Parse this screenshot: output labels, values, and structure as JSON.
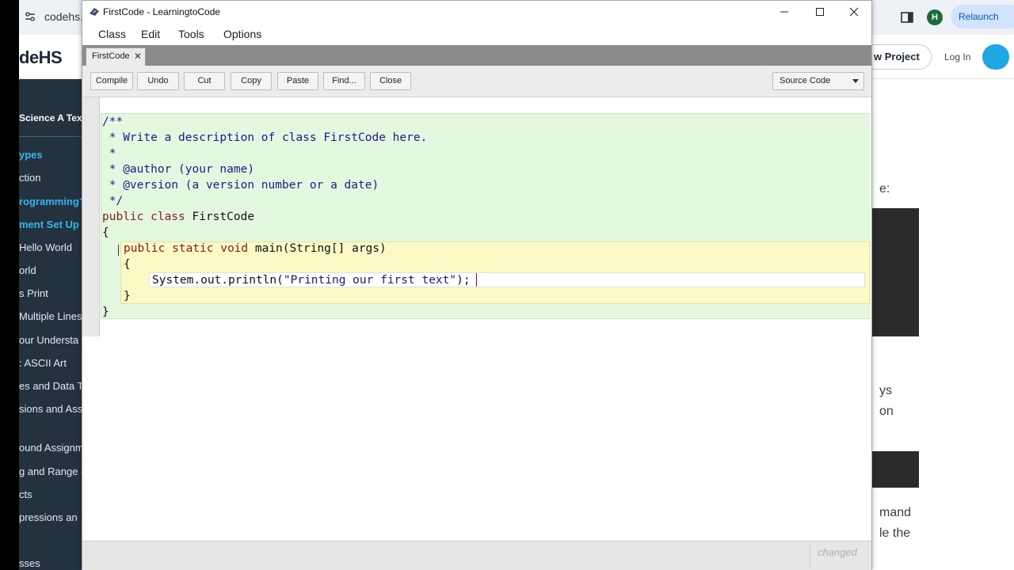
{
  "browser": {
    "url": "codehs.c",
    "relaunch_label": "Relaunch",
    "profile_initial": "H"
  },
  "codehs": {
    "logo": "deHS",
    "new_project_label": "w Project",
    "login_label": "Log In",
    "course_title": "Science A Text",
    "sidebar_items": [
      {
        "label": "ypes",
        "highlight": true
      },
      {
        "label": "ction",
        "highlight": false
      },
      {
        "label": "rogramming?",
        "highlight": true
      },
      {
        "label": "ment Set Up",
        "highlight": true
      },
      {
        "label": "Hello World",
        "highlight": false
      },
      {
        "label": "orld",
        "highlight": false
      },
      {
        "label": "s Print",
        "highlight": false
      },
      {
        "label": "Multiple Lines",
        "highlight": false
      },
      {
        "label": "our Understa",
        "highlight": false
      },
      {
        "label": ": ASCII Art",
        "highlight": false
      },
      {
        "label": "es and Data T",
        "highlight": false
      },
      {
        "label": "sions and Ass",
        "highlight": false
      },
      {
        "label": "ound Assignm",
        "highlight": false
      },
      {
        "label": "g and Range c",
        "highlight": false
      },
      {
        "label": "cts",
        "highlight": false
      },
      {
        "label": "pressions an",
        "highlight": false
      },
      {
        "label": "sses",
        "highlight": false
      }
    ],
    "right_texts": [
      "e:",
      "ys",
      "on",
      "mand",
      "le the"
    ]
  },
  "bluej": {
    "window_title": "FirstCode - LearningtoCode",
    "menus": [
      "Class",
      "Edit",
      "Tools",
      "Options"
    ],
    "tab_label": "FirstCode",
    "tab_close": "✕",
    "toolbar": {
      "compile": "Compile",
      "undo": "Undo",
      "cut": "Cut",
      "copy": "Copy",
      "paste": "Paste",
      "find": "Find...",
      "close": "Close"
    },
    "view_select": "Source Code",
    "code": {
      "l1": "/**",
      "l2": " * Write a description of class FirstCode here.",
      "l3": " *",
      "l4": " * @author (your name)",
      "l5": " * @version (a version number or a date)",
      "l6": " */",
      "l7_kw": "public class",
      "l7_name": " FirstCode",
      "l8": "{",
      "l9_kw": "public static void",
      "l9_rest": " main(String[] args)",
      "l10": "{",
      "l11_pre": "System.out.println(",
      "l11_str": "\"Printing our first text\"",
      "l11_post": ");",
      "l12": "}",
      "l13": "}"
    },
    "status": "changed"
  }
}
